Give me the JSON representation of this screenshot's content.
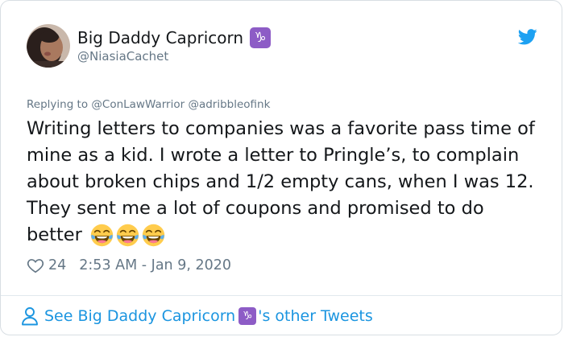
{
  "tweet": {
    "author": {
      "display_name": "Big Daddy Capricorn",
      "badge_emoji": "♑",
      "handle": "@NiasiaCachet",
      "avatar_icon": "avatar-photo"
    },
    "platform_icon": "twitter-bird-icon",
    "replying_to": "Replying to @ConLawWarrior @adribbleofink",
    "text": "Writing letters to companies was a favorite pass time of mine as a kid. I wrote a letter to Pringle’s, to complain about broken chips and 1/2 empty cans, when I was 12. They sent me a lot of coupons and promised to do better",
    "emojis": [
      "😂",
      "😂",
      "😂"
    ],
    "likes": "24",
    "timestamp": "2:53 AM - Jan 9, 2020"
  },
  "footer": {
    "see_more_prefix": "See Big Daddy Capricorn",
    "see_more_emoji": "♑",
    "see_more_suffix": "'s other Tweets"
  },
  "colors": {
    "accent": "#1b95e0",
    "twitter_blue": "#1da1f2",
    "muted": "#657786",
    "text": "#14171a",
    "zodiac_badge": "#8d5cc6"
  }
}
